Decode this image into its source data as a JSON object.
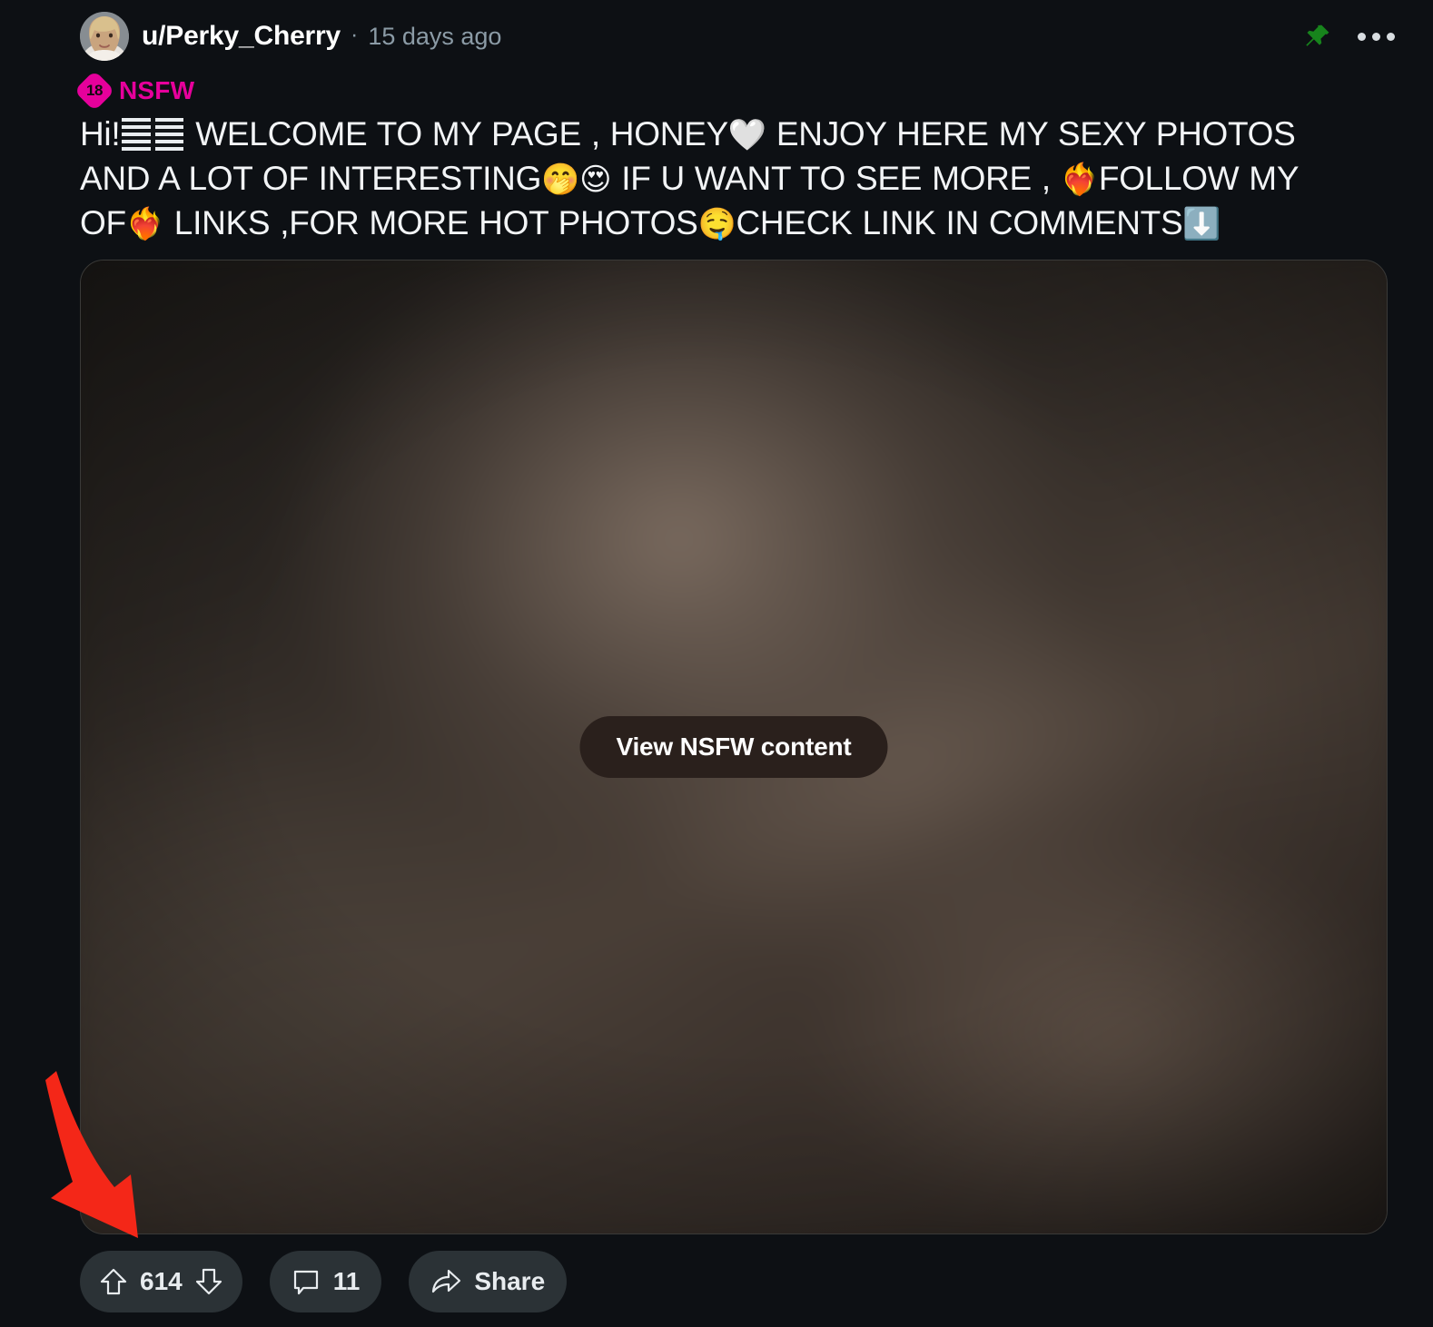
{
  "post": {
    "author": "u/Perky_Cherry",
    "separator": "·",
    "timestamp": "15 days ago",
    "pin_icon": "pushpin-icon",
    "overflow_icon": "more-options-icon",
    "avatar_alt": "avatar",
    "nsfw": {
      "age": "18",
      "label": "NSFW",
      "color": "#e6009b"
    },
    "title_segments": [
      {
        "type": "text",
        "value": "Hi!"
      },
      {
        "type": "tofu",
        "value": "☷"
      },
      {
        "type": "text",
        "value": " WELCOME TO MY PAGE , HONEY"
      },
      {
        "type": "emoji",
        "value": "🤍",
        "name": "white-heart-emoji"
      },
      {
        "type": "text",
        "value": " ENJOY HERE MY SEXY PHOTOS AND A LOT OF INTERESTING"
      },
      {
        "type": "emoji",
        "value": "🤭",
        "name": "face-with-hand-over-mouth-emoji"
      },
      {
        "type": "emoji",
        "value": "😍",
        "name": "smiling-face-with-heart-eyes-emoji"
      },
      {
        "type": "text",
        "value": " IF U WANT TO SEE MORE , "
      },
      {
        "type": "emoji",
        "value": "❤️‍🔥",
        "name": "heart-on-fire-emoji"
      },
      {
        "type": "text",
        "value": "FOLLOW MY OF"
      },
      {
        "type": "emoji",
        "value": "❤️‍🔥",
        "name": "heart-on-fire-emoji"
      },
      {
        "type": "text",
        "value": " LINKS ,FOR MORE HOT PHOTOS"
      },
      {
        "type": "emoji",
        "value": "🤤",
        "name": "drooling-face-emoji"
      },
      {
        "type": "text",
        "value": "CHECK LINK IN COMMENTS"
      },
      {
        "type": "emoji",
        "value": "⬇️",
        "name": "down-arrow-emoji"
      }
    ],
    "title_plain": "Hi! WELCOME TO MY PAGE , HONEY ENJOY HERE MY SEXY PHOTOS AND A LOT OF INTERESTING IF U WANT TO SEE MORE , FOLLOW MY OF LINKS ,FOR MORE HOT PHOTOS CHECK LINK IN COMMENTS",
    "media": {
      "blurred": true,
      "reveal_button_label": "View NSFW content"
    },
    "annotation": {
      "type": "red-arrow",
      "color": "#f42718",
      "points_to": "vote-bar"
    },
    "actions": {
      "upvote_icon": "upvote-arrow-icon",
      "downvote_icon": "downvote-arrow-icon",
      "vote_count": "614",
      "comment_icon": "comment-bubble-icon",
      "comment_count": "11",
      "share_icon": "share-arrow-icon",
      "share_label": "Share"
    }
  },
  "theme": {
    "background": "#0d1014",
    "text_primary": "#f2f4f6",
    "text_muted": "#8b9ba6",
    "pill_background": "#2b3236",
    "nsfw_accent": "#e6009b",
    "pin_green": "#1a8a1f"
  }
}
